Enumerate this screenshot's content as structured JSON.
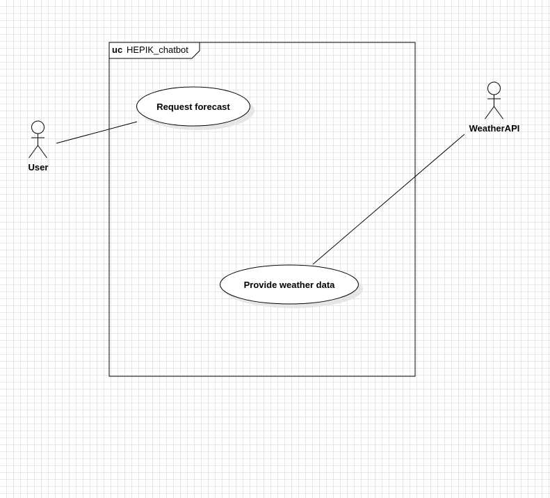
{
  "system": {
    "keyword": "uc",
    "name": "HEPIK_chatbot"
  },
  "actors": [
    {
      "id": "user",
      "label": "User"
    },
    {
      "id": "weatherapi",
      "label": "WeatherAPI"
    }
  ],
  "use_cases": [
    {
      "id": "request-forecast",
      "label": "Request forecast"
    },
    {
      "id": "provide-weather-data",
      "label": "Provide weather data"
    }
  ],
  "associations": [
    {
      "from": "user",
      "to": "request-forecast"
    },
    {
      "from": "weatherapi",
      "to": "provide-weather-data"
    }
  ],
  "colors": {
    "stroke": "#000000",
    "fill": "#ffffff",
    "shadow": "#e6e6e6",
    "grid": "#e6e6e6"
  }
}
